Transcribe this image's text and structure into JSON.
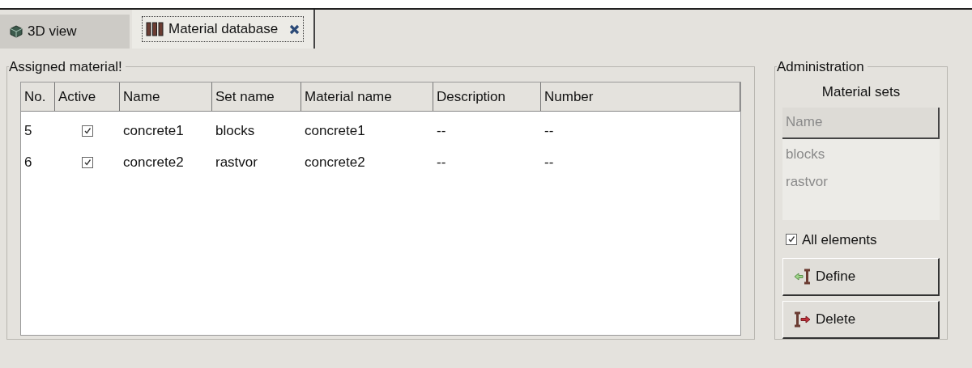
{
  "tabs": [
    {
      "label": "3D view",
      "selected": false,
      "closable": false
    },
    {
      "label": "Material database",
      "selected": true,
      "closable": true
    }
  ],
  "assigned": {
    "title": "Assigned material!",
    "columns": [
      "No.",
      "Active",
      "Name",
      "Set name",
      "Material name",
      "Description",
      "Number"
    ],
    "rows": [
      {
        "no": "5",
        "active": true,
        "name": "concrete1",
        "set_name": "blocks",
        "material_name": "concrete1",
        "description": "--",
        "number": "--"
      },
      {
        "no": "6",
        "active": true,
        "name": "concrete2",
        "set_name": "rastvor",
        "material_name": "concrete2",
        "description": "--",
        "number": "--"
      }
    ]
  },
  "administration": {
    "title": "Administration",
    "sets_title": "Material sets",
    "sets_list": {
      "disabled": true,
      "header": "Name",
      "items": [
        "blocks",
        "rastvor"
      ]
    },
    "all_elements": {
      "label": "All elements",
      "checked": true
    },
    "buttons": [
      {
        "label": "Define",
        "kind": "define"
      },
      {
        "label": "Delete",
        "kind": "delete"
      }
    ]
  }
}
